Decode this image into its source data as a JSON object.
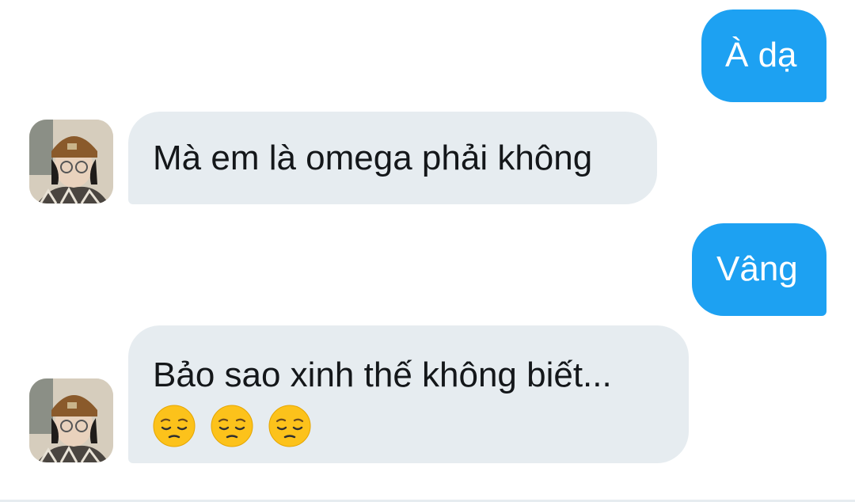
{
  "messages": [
    {
      "direction": "sent",
      "text": "À dạ"
    },
    {
      "direction": "received",
      "text": "Mà em là omega phải không"
    },
    {
      "direction": "sent",
      "text": "Vâng"
    },
    {
      "direction": "received",
      "text": "Bảo sao xinh thế không biết...",
      "emoji": [
        "pensive-face",
        "pensive-face",
        "pensive-face"
      ]
    }
  ],
  "colors": {
    "sent_bubble": "#1da1f2",
    "received_bubble": "#e6ecf0",
    "sent_text": "#ffffff",
    "received_text": "#14171a"
  }
}
